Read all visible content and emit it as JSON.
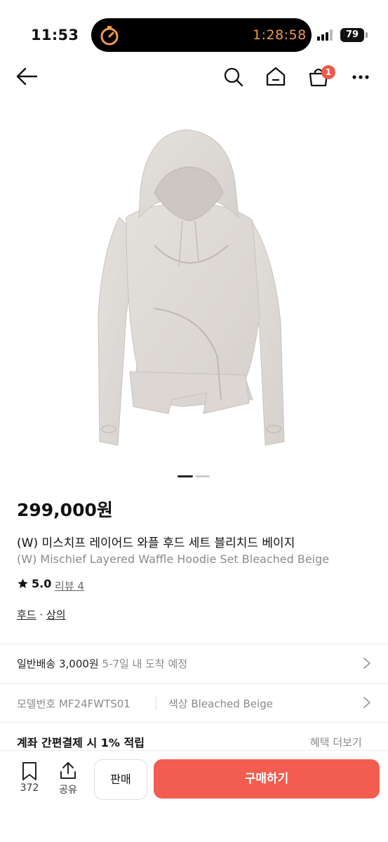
{
  "status_bar": {
    "time": "11:53",
    "timer": "1:28:58",
    "battery": "79"
  },
  "nav": {
    "cart_count": "1",
    "icons": [
      "back-arrow-icon",
      "search-icon",
      "home-icon",
      "cart-icon",
      "more-icon"
    ]
  },
  "product": {
    "price": "299,000원",
    "name_ko": "(W) 미스치프 레이어드 와플 후드 세트 블리치드 베이지",
    "name_en": "(W) Mischief Layered Waffle Hoodie Set Bleached Beige",
    "rating": "5.0",
    "review_label": "리뷰 4",
    "category_1": "후드",
    "category_sep": "·",
    "category_2": "상의",
    "image_count": 2,
    "image_active": 1
  },
  "shipping": {
    "label": "일반배송 3,000원",
    "eta": "5-7일 내 도착 예정"
  },
  "spec": {
    "model_label": "모델번호 MF24FWTS01",
    "color_label": "색상 Bleached Beige"
  },
  "benefit": {
    "text": "계좌 간편결제 시 1% 적립",
    "more": "혜택 더보기"
  },
  "bottom": {
    "bookmark_count": "372",
    "share_label": "공유",
    "sell_label": "판매",
    "buy_label": "구매하기"
  },
  "colors": {
    "accent": "#f25d4f",
    "badge": "#f0594a",
    "timer": "#f39a4a"
  }
}
